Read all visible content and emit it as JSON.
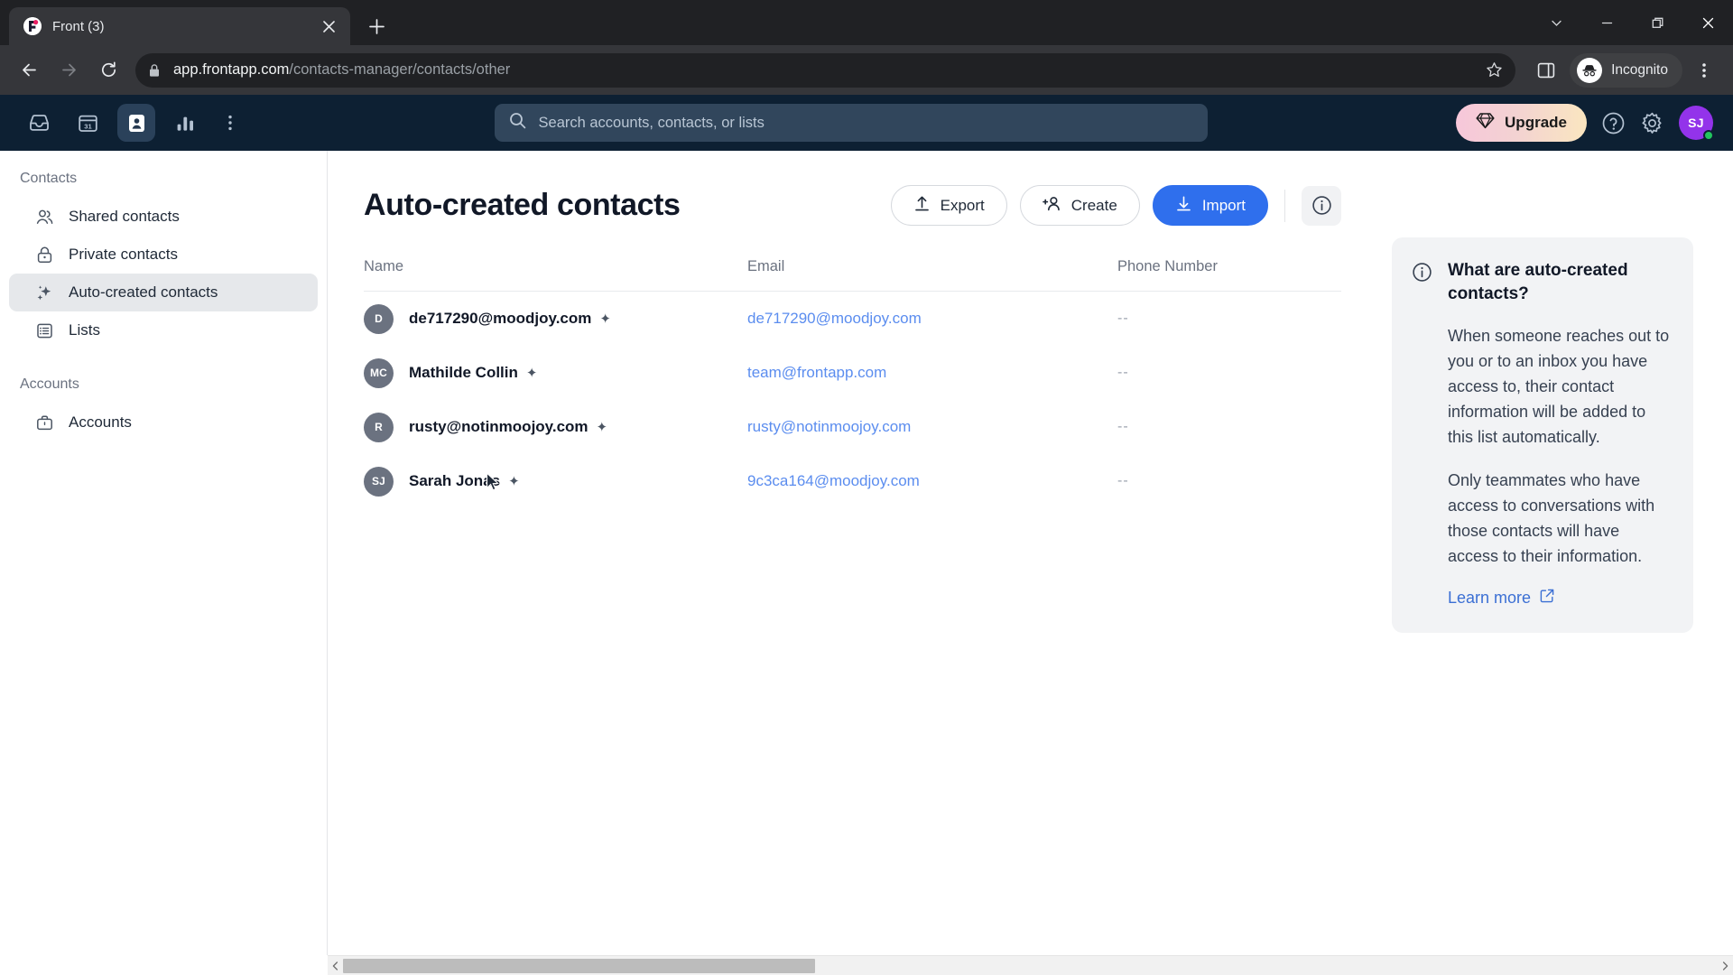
{
  "browser": {
    "tab": {
      "title": "Front (3)",
      "favicon_letter": "F",
      "close_icon": "close-icon"
    },
    "new_tab_label": "+",
    "window_controls": [
      "chevron-down-icon",
      "minimize-icon",
      "maximize-icon",
      "close-icon"
    ],
    "nav": {
      "back": "back-arrow-icon",
      "forward": "forward-arrow-icon",
      "reload": "reload-icon"
    },
    "omnibox": {
      "lock_icon": "lock-icon",
      "url_host": "app.frontapp.com",
      "url_path": "/contacts-manager/contacts/other",
      "star_icon": "bookmark-star-icon"
    },
    "toolbar_icons": [
      "side-panel-icon",
      "more-vertical-icon"
    ],
    "incognito_label": "Incognito"
  },
  "app_header": {
    "nav_items": [
      {
        "name": "inbox",
        "icon": "inbox-icon",
        "active": false
      },
      {
        "name": "calendar",
        "icon": "calendar-31-icon",
        "active": false
      },
      {
        "name": "contacts",
        "icon": "contact-card-icon",
        "active": true
      },
      {
        "name": "analytics",
        "icon": "bar-chart-icon",
        "active": false
      },
      {
        "name": "more",
        "icon": "more-vertical-icon",
        "active": false
      }
    ],
    "search": {
      "placeholder": "Search accounts, contacts, or lists",
      "icon": "search-icon"
    },
    "upgrade_label": "Upgrade",
    "upgrade_icon": "diamond-icon",
    "help_icon": "help-circle-icon",
    "settings_icon": "gear-icon",
    "avatar": {
      "initials": "SJ",
      "color": "#9333ea",
      "status_color": "#22c55e"
    }
  },
  "sidebar": {
    "sections": [
      {
        "label": "Contacts",
        "items": [
          {
            "label": "Shared contacts",
            "icon": "people-icon",
            "active": false
          },
          {
            "label": "Private contacts",
            "icon": "lock-icon",
            "active": false
          },
          {
            "label": "Auto-created contacts",
            "icon": "sparkles-icon",
            "active": true
          },
          {
            "label": "Lists",
            "icon": "list-icon",
            "active": false
          }
        ]
      },
      {
        "label": "Accounts",
        "items": [
          {
            "label": "Accounts",
            "icon": "briefcase-icon",
            "active": false
          }
        ]
      }
    ]
  },
  "main": {
    "title": "Auto-created contacts",
    "actions": {
      "export": {
        "label": "Export",
        "icon": "upload-icon"
      },
      "create": {
        "label": "Create",
        "icon": "person-plus-icon"
      },
      "import": {
        "label": "Import",
        "icon": "download-icon",
        "color": "#2f6fed"
      },
      "info": {
        "icon": "info-circle-icon"
      }
    },
    "table": {
      "columns": [
        "Name",
        "Email",
        "Phone Number"
      ],
      "rows": [
        {
          "initials": "D",
          "name": "de717290@moodjoy.com",
          "badge": "sparkles-icon",
          "email": "de717290@moodjoy.com",
          "phone": "--"
        },
        {
          "initials": "MC",
          "name": "Mathilde Collin",
          "badge": "sparkles-icon",
          "email": "team@frontapp.com",
          "phone": "--"
        },
        {
          "initials": "R",
          "name": "rusty@notinmoojoy.com",
          "badge": "sparkles-icon",
          "email": "rusty@notinmoojoy.com",
          "phone": "--"
        },
        {
          "initials": "SJ",
          "name": "Sarah Jonas",
          "badge": "sparkles-icon",
          "email": "9c3ca164@moodjoy.com",
          "phone": "--"
        }
      ]
    }
  },
  "info_panel": {
    "icon": "info-circle-icon",
    "title": "What are auto-created contacts?",
    "paragraph1": "When someone reaches out to you or to an inbox you have access to, their contact information will be added to this list automatically.",
    "paragraph2": "Only teammates who have access to conversations with those contacts will have access to their information.",
    "learn_more": "Learn more",
    "learn_more_icon": "external-link-icon"
  },
  "scrollbar": {
    "left_arrow": "chevron-left-icon",
    "right_arrow": "chevron-right-icon"
  }
}
